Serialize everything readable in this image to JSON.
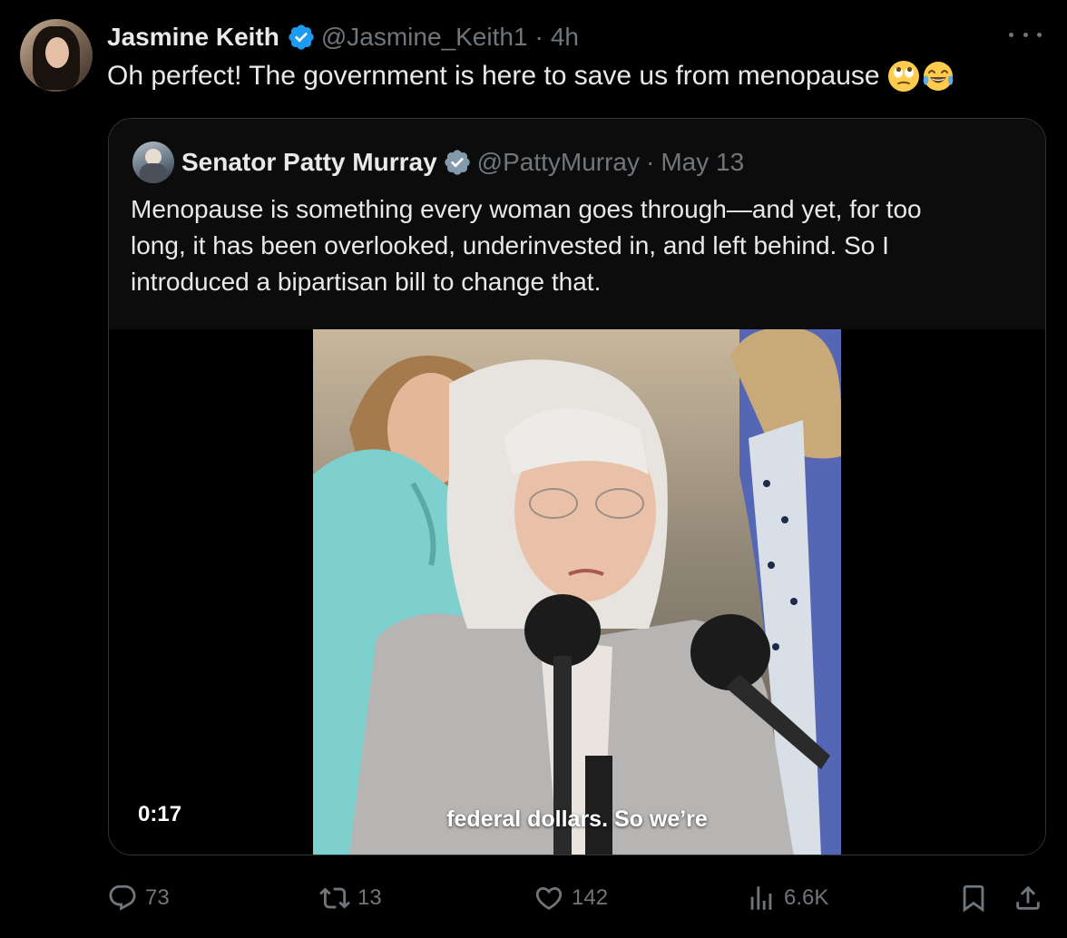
{
  "tweet": {
    "display_name": "Jasmine Keith",
    "handle": "@Jasmine_Keith1",
    "separator": "·",
    "time": "4h",
    "text": "Oh perfect! The government is here to save us from menopause",
    "emojis": [
      "face-with-rolling-eyes",
      "face-with-tears-of-joy"
    ]
  },
  "quoted_tweet": {
    "display_name": "Senator Patty Murray",
    "handle": "@PattyMurray",
    "separator": "·",
    "date": "May 13",
    "text_lines": [
      "Menopause is something every woman goes through—and yet, for too",
      "long, it has been overlooked, underinvested in, and left behind. So I",
      "introduced a bipartisan bill to change that."
    ],
    "video": {
      "duration": "0:17",
      "caption": "federal dollars. So we’re"
    }
  },
  "actions": {
    "replies": "73",
    "reposts": "13",
    "likes": "142",
    "views": "6.6K"
  },
  "colors": {
    "background": "#000000",
    "text": "#e7e9ea",
    "muted": "#71767b",
    "verified": "#1d9bf0",
    "border": "#2f3336"
  }
}
